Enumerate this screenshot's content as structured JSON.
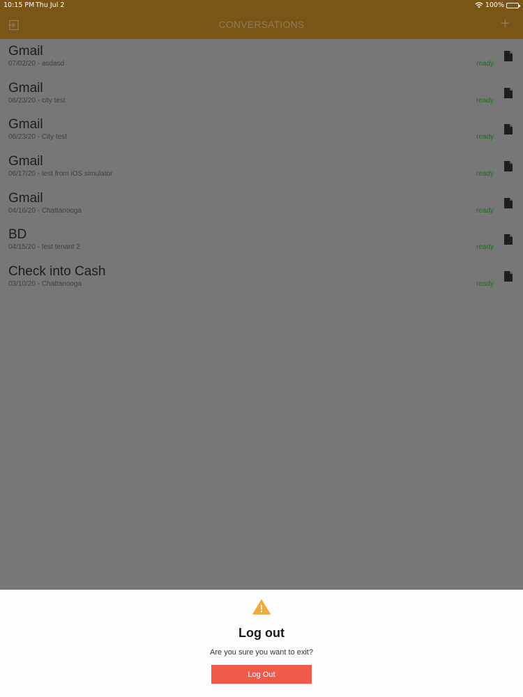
{
  "status_bar": {
    "time": "10:15 PM",
    "date": "Thu Jul 2",
    "battery": "100%"
  },
  "nav": {
    "title": "CONVERSATIONS",
    "add_label": "+",
    "icons": {
      "left": "logout-icon",
      "right": "plus-icon"
    }
  },
  "conversations": [
    {
      "title": "Gmail",
      "subtitle": "07/02/20 - asdasd",
      "status": "ready"
    },
    {
      "title": "Gmail",
      "subtitle": "06/23/20 - city test",
      "status": "ready"
    },
    {
      "title": "Gmail",
      "subtitle": "06/23/20 - City test",
      "status": "ready"
    },
    {
      "title": "Gmail",
      "subtitle": "06/17/20 - test from iOS simulator",
      "status": "ready"
    },
    {
      "title": "Gmail",
      "subtitle": "04/16/20 - Chattanooga",
      "status": "ready"
    },
    {
      "title": "BD",
      "subtitle": "04/15/20 - test tenant 2",
      "status": "ready"
    },
    {
      "title": "Check into Cash",
      "subtitle": "03/10/20 - Chattanooga",
      "status": "ready"
    }
  ],
  "dialog": {
    "title": "Log out",
    "message": "Are you sure you want to exit?",
    "button_label": "Log Out",
    "icon": "warning-icon"
  },
  "colors": {
    "nav_bar": "#7a5517",
    "overlay": "#777777",
    "status_ready": "#1f6b1f",
    "warning": "#f4a93b",
    "button": "#ef5a4a"
  }
}
